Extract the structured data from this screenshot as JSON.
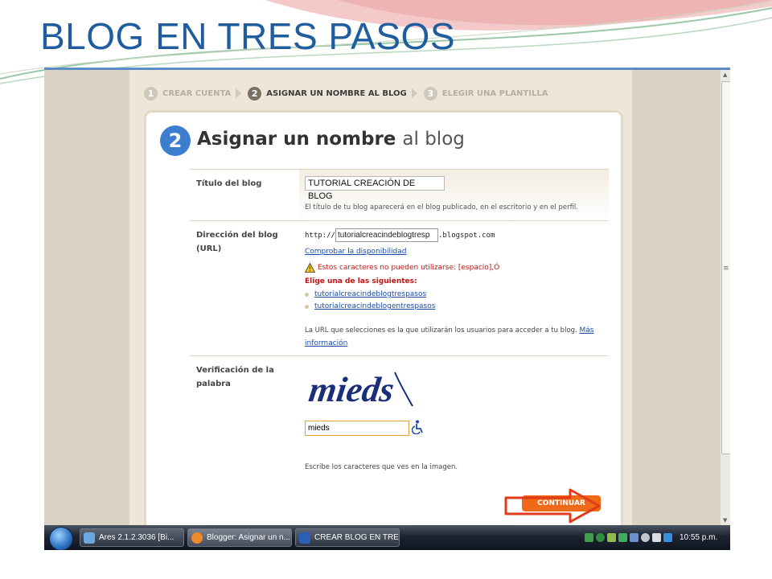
{
  "slide": {
    "title": "BLOG EN TRES PASOS"
  },
  "steps": [
    {
      "num": "1",
      "label": "CREAR CUENTA",
      "active": false
    },
    {
      "num": "2",
      "label": "ASIGNAR UN NOMBRE AL BLOG",
      "active": true
    },
    {
      "num": "3",
      "label": "ELEGIR UNA PLANTILLA",
      "active": false
    }
  ],
  "heading": {
    "num": "2",
    "bold": "Asignar un nombre",
    "light": "al blog"
  },
  "blog_title": {
    "label": "Título del blog",
    "value": "TUTORIAL CREACIÓN DE BLOG",
    "help": "El título de tu blog aparecerá en el blog publicado, en el escritorio y en el perfil."
  },
  "blog_url": {
    "label_line1": "Dirección del blog",
    "label_line2": "(URL)",
    "prefix": "http://",
    "value": "tutorialcreacindeblogtresp",
    "suffix": ".blogspot.com",
    "check_link": "Comprobar la disponibilidad",
    "warning": "Estos caracteres no pueden utilizarse: [espacio],Ó",
    "choose": "Elige una de las siguientes:",
    "suggestions": [
      "tutorialcreacindeblogtrespasos",
      "tutorialcreacindeblogentrespasos"
    ],
    "help_text": "La URL que selecciones es la que utilizarán los usuarios para acceder a tu blog.",
    "more_info_1": "Más",
    "more_info_2": "información"
  },
  "captcha": {
    "label_line1": "Verificación de la",
    "label_line2": "palabra",
    "image_text": "mieds",
    "value": "mieds",
    "help": "Escribe los caracteres que ves en la imagen."
  },
  "continue_label": "CONTINUAR",
  "taskbar": {
    "buttons": [
      {
        "label": "Ares 2.1.2.3036   [Bi...",
        "color": "#6aa8e0",
        "active": false
      },
      {
        "label": "Blogger: Asignar un n...",
        "color": "#ef8a2a",
        "active": true
      },
      {
        "label": "CREAR BLOG EN TRES...",
        "color": "#2b5fb5",
        "active": false
      }
    ],
    "clock": "10:55 p.m."
  },
  "colors": {
    "title": "#1f5d9e",
    "accent_orange": "#ee6a16",
    "link": "#1a4ca8",
    "error": "#c11515"
  }
}
